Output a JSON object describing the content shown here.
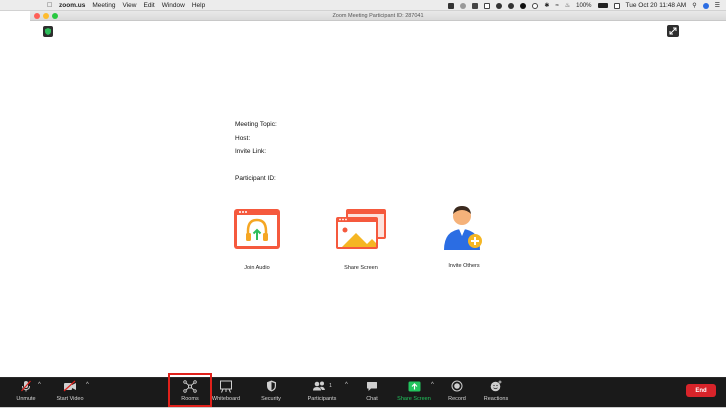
{
  "menubar": {
    "app": "zoom.us",
    "items": [
      "Meeting",
      "View",
      "Edit",
      "Window",
      "Help"
    ],
    "battery": "100%",
    "datetime": "Tue Oct 20  11:48 AM"
  },
  "window": {
    "title": "Zoom Meeting Participant ID: 287041"
  },
  "meeting_info": {
    "topic_label": "Meeting Topic:",
    "host_label": "Host:",
    "invite_link_label": "Invite Link:",
    "participant_id_label": "Participant ID:"
  },
  "actions": [
    {
      "label": "Join Audio",
      "icon": "headphones-icon"
    },
    {
      "label": "Share Screen",
      "icon": "share-screen-icon"
    },
    {
      "label": "Invite Others",
      "icon": "invite-person-icon"
    }
  ],
  "toolbar": {
    "unmute": "Unmute",
    "start_video": "Start Video",
    "rooms": "Rooms",
    "whiteboard": "Whiteboard",
    "security": "Security",
    "participants": "Participants",
    "participants_count": "1",
    "chat": "Chat",
    "share_screen": "Share Screen",
    "record": "Record",
    "reactions": "Reactions",
    "end": "End"
  },
  "colors": {
    "end_red": "#d8242a",
    "share_green": "#22c55e",
    "highlight_red": "#e0211b",
    "icon_orange": "#f5593d"
  }
}
